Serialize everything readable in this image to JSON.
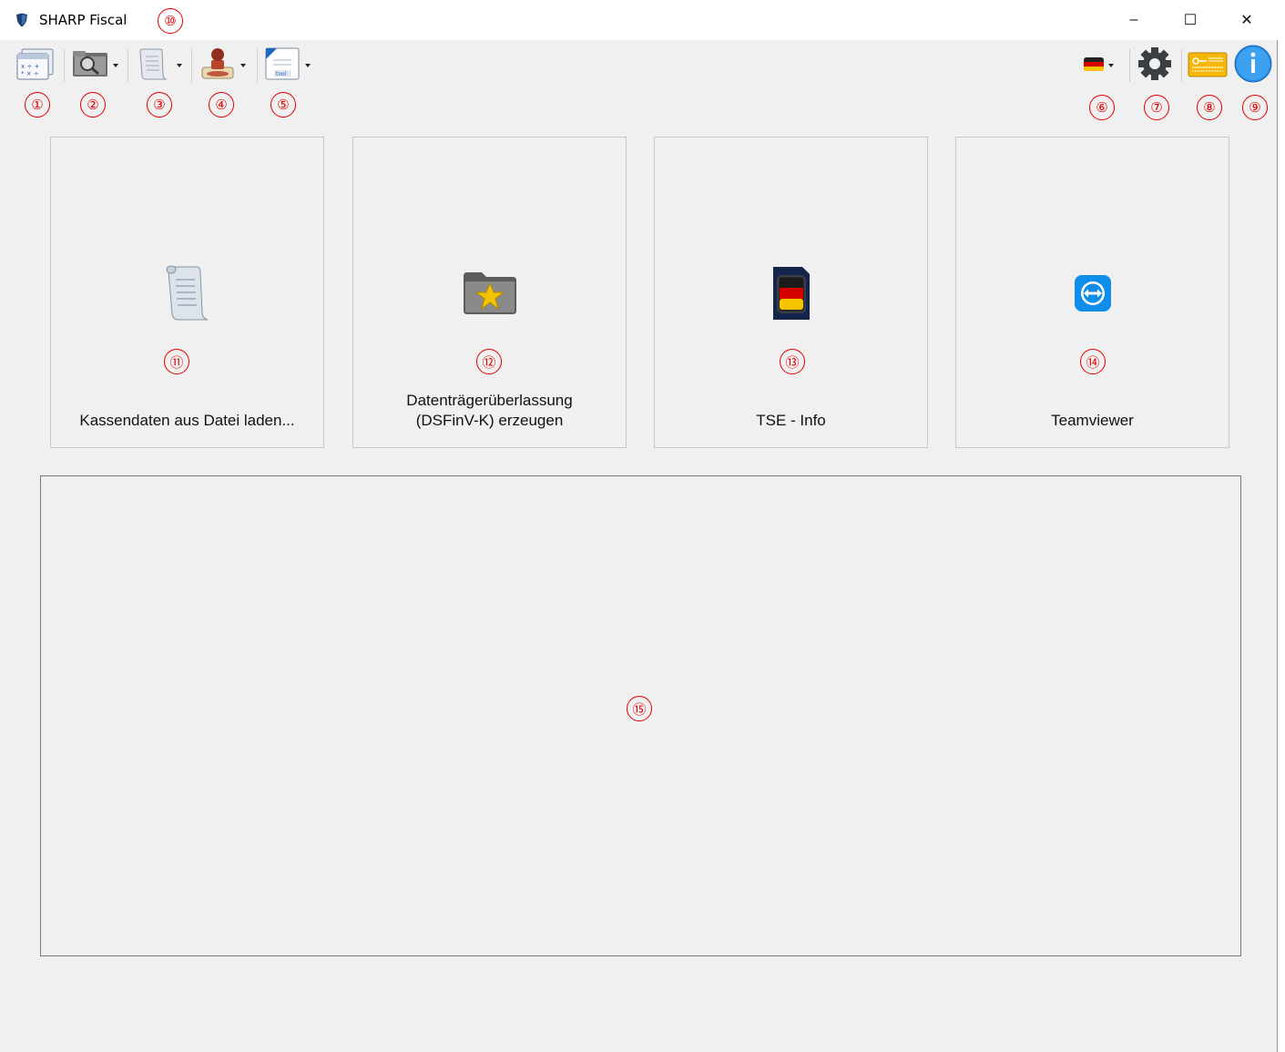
{
  "window": {
    "title": "SHARP Fiscal",
    "minimize_glyph": "–",
    "maximize_glyph": "☐",
    "close_glyph": "✕"
  },
  "toolbar": {
    "left_buttons": [
      {
        "name": "cash-register-icon",
        "has_dropdown": false
      },
      {
        "name": "search-folder-icon",
        "has_dropdown": true
      },
      {
        "name": "document-scroll-icon",
        "has_dropdown": true
      },
      {
        "name": "stamp-icon",
        "has_dropdown": true
      },
      {
        "name": "tool-document-icon",
        "has_dropdown": true
      }
    ],
    "right_buttons": [
      {
        "name": "german-flag-icon",
        "has_dropdown": true
      },
      {
        "name": "settings-gear-icon",
        "has_dropdown": false
      },
      {
        "name": "license-key-icon",
        "has_dropdown": false
      },
      {
        "name": "info-icon",
        "has_dropdown": false
      }
    ]
  },
  "tiles": [
    {
      "label": "Kassendaten aus Datei laden...",
      "icon": "document-scroll-icon"
    },
    {
      "label": "Datenträgerüberlassung\n(DSFinV-K) erzeugen",
      "icon": "star-folder-icon"
    },
    {
      "label": "TSE - Info",
      "icon": "sd-card-icon"
    },
    {
      "label": "Teamviewer",
      "icon": "teamviewer-icon"
    }
  ],
  "markers": [
    "①",
    "②",
    "③",
    "④",
    "⑤",
    "⑥",
    "⑦",
    "⑧",
    "⑨",
    "⑩",
    "⑪",
    "⑫",
    "⑬",
    "⑭",
    "⑮"
  ],
  "colors": {
    "marker": "#e00000",
    "background": "#f0f0f0",
    "teamviewer_blue": "#0e8ee9",
    "info_blue": "#1e88e5"
  }
}
